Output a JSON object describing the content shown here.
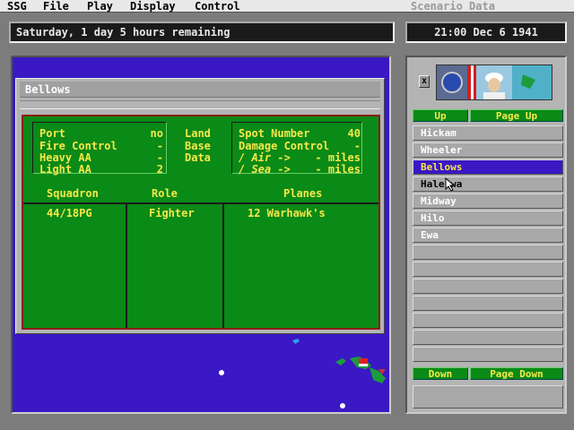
{
  "menu": {
    "items": [
      "SSG",
      "File",
      "Play",
      "Display",
      "Control"
    ],
    "right_label": "Scenario Data"
  },
  "status": {
    "message": "Saturday, 1 day 5 hours remaining"
  },
  "clock": {
    "time": "21:00 Dec 6 1941"
  },
  "base": {
    "name": "Bellows",
    "stats_left": [
      {
        "label": "Port",
        "value": "no"
      },
      {
        "label": "Fire Control",
        "value": "-"
      },
      {
        "label": "Heavy AA",
        "value": "-"
      },
      {
        "label": "Light AA",
        "value": "2"
      }
    ],
    "middle_label": [
      "Land",
      "Base",
      "Data"
    ],
    "stats_right": [
      {
        "label": "Spot Number",
        "value": "40"
      },
      {
        "label": "Damage Control",
        "value": "-"
      },
      {
        "label": "/ Air ->",
        "value": "- miles"
      },
      {
        "label": "/ Sea ->",
        "value": "- miles"
      }
    ],
    "columns": [
      "Squadron",
      "Role",
      "Planes"
    ],
    "rows": [
      {
        "squadron": "44/18PG",
        "role": "Fighter",
        "planes": "12 Warhawk's"
      }
    ]
  },
  "sidebar": {
    "close_label": "x",
    "up": "Up",
    "page_up": "Page Up",
    "down": "Down",
    "page_down": "Page Down",
    "bases": [
      "Hickam",
      "Wheeler",
      "Bellows",
      "Haleiwa",
      "Midway",
      "Hilo",
      "Ewa"
    ],
    "selected": "Bellows"
  },
  "colors": {
    "map_sea": "#3a18c4",
    "panel_green": "#0a8a16",
    "label_yellow": "#f6e84a",
    "panel_border_red": "#8a1e14"
  }
}
